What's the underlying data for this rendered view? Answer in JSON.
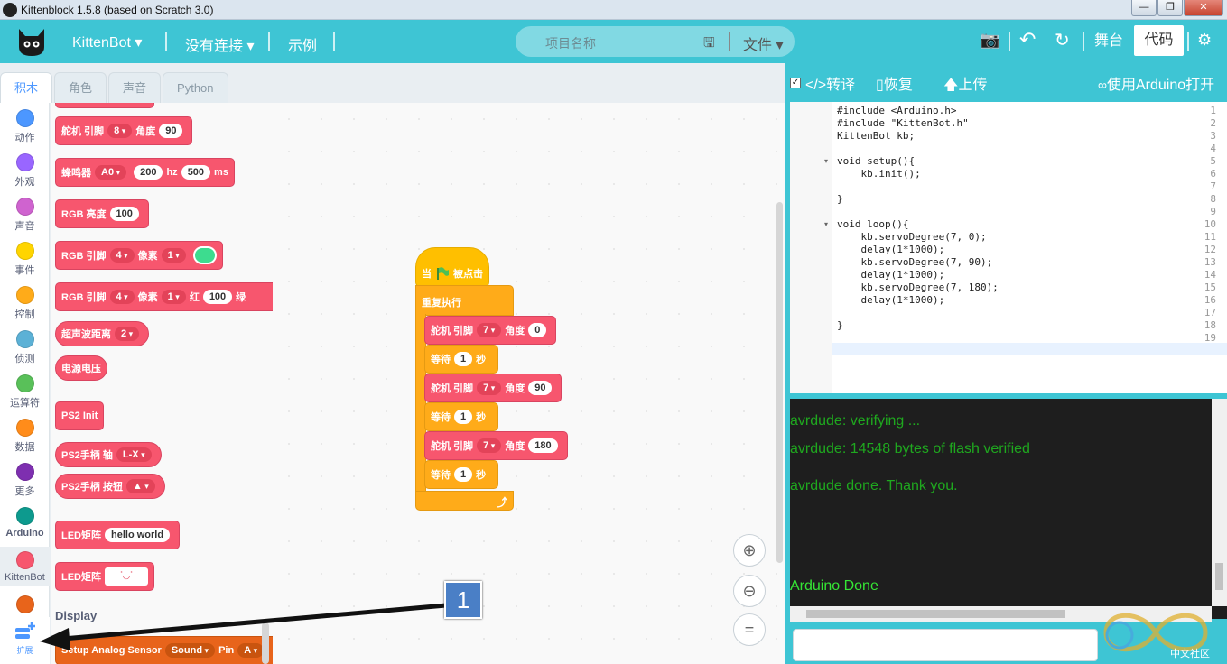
{
  "window": {
    "title": "Kittenblock 1.5.8 (based on Scratch 3.0)",
    "min": "—",
    "max": "❐",
    "close": "✕"
  },
  "menu": {
    "brand": "KittenBot ▾",
    "connect": "没有连接 ▾",
    "examples": "示例",
    "project_placeholder": "项目名称",
    "save_icon": "🖫",
    "file": "文件 ▾",
    "camera_icon": "📷",
    "undo_icon": "↶",
    "redo_icon": "↻",
    "stage": "舞台",
    "code": "代码",
    "settings_icon": "⚙"
  },
  "tabs": [
    "积木",
    "角色",
    "声音",
    "Python"
  ],
  "categories": [
    {
      "label": "动作",
      "color": "#4c97ff"
    },
    {
      "label": "外观",
      "color": "#9966ff"
    },
    {
      "label": "声音",
      "color": "#cf63cf"
    },
    {
      "label": "事件",
      "color": "#ffd500"
    },
    {
      "label": "控制",
      "color": "#ffab19"
    },
    {
      "label": "侦测",
      "color": "#5cb1d6"
    },
    {
      "label": "运算符",
      "color": "#59c059"
    },
    {
      "label": "数据",
      "color": "#ff8c1a"
    },
    {
      "label": "更多",
      "color": "#7e2fb0"
    },
    {
      "label": "Arduino",
      "color": "#0d9a8e"
    },
    {
      "label": "KittenBot",
      "color": "#f7566e"
    },
    {
      "label": "",
      "color": "#e8641b"
    }
  ],
  "extension_label": "扩展",
  "palette": {
    "servo": {
      "label": "舵机 引脚",
      "pin": "8",
      "angle_label": "角度",
      "angle": "90"
    },
    "buzzer": {
      "label": "蜂鸣器",
      "pin": "A0",
      "freq": "200",
      "hz": "hz",
      "dur": "500",
      "ms": "ms"
    },
    "rgb_brightness": {
      "label": "RGB 亮度",
      "value": "100"
    },
    "rgb_pixel": {
      "label": "RGB 引脚",
      "pin": "4",
      "pixel_label": "像素",
      "pixel": "1"
    },
    "rgb_pixel_rgb": {
      "label": "RGB 引脚",
      "pin": "4",
      "pixel_label": "像素",
      "pixel": "1",
      "red_label": "红",
      "red": "100",
      "green_label": "绿"
    },
    "ultrasonic": {
      "label": "超声波距离",
      "pin": "2"
    },
    "voltage": {
      "label": "电源电压"
    },
    "ps2_init": {
      "label": "PS2 Init"
    },
    "ps2_axis": {
      "label": "PS2手柄 轴",
      "axis": "L-X"
    },
    "ps2_button": {
      "label": "PS2手柄 按钮",
      "button": "▲"
    },
    "led_text": {
      "label": "LED矩阵",
      "text": "hello world"
    },
    "led_face": {
      "label": "LED矩阵",
      "face": "˙◡˙"
    },
    "section_display": "Display",
    "analog_sensor": {
      "label": "Setup Analog Sensor",
      "sensor": "Sound",
      "pin_label": "Pin",
      "pin": "A"
    }
  },
  "script": {
    "hat": {
      "when": "当",
      "clicked": "被点击"
    },
    "forever": "重复执行",
    "servo_label": "舵机 引脚",
    "angle_label": "角度",
    "wait_label": "等待",
    "sec_label": "秒",
    "steps": [
      {
        "pin": "7",
        "angle": "0"
      },
      {
        "wait": "1"
      },
      {
        "pin": "7",
        "angle": "90"
      },
      {
        "wait": "1"
      },
      {
        "pin": "7",
        "angle": "180"
      },
      {
        "wait": "1"
      }
    ],
    "loop_arrow": "⤴"
  },
  "zoom": {
    "in": "⊕",
    "out": "⊖",
    "reset": "="
  },
  "toolbar": {
    "compile": "</>转译",
    "restore": "恢复",
    "upload": "上传",
    "open_arduino": "使用Arduino打开"
  },
  "code_lines": [
    "#include <Arduino.h>",
    "#include \"KittenBot.h\"",
    "KittenBot kb;",
    "",
    "void setup(){",
    "    kb.init();",
    "",
    "}",
    "",
    "void loop(){",
    "    kb.servoDegree(7, 0);",
    "    delay(1*1000);",
    "    kb.servoDegree(7, 90);",
    "    delay(1*1000);",
    "    kb.servoDegree(7, 180);",
    "    delay(1*1000);",
    "",
    "}",
    ""
  ],
  "line_numbers": [
    "1",
    "2",
    "3",
    "4",
    "5",
    "6",
    "7",
    "8",
    "9",
    "10",
    "11",
    "12",
    "13",
    "14",
    "15",
    "16",
    "17",
    "18",
    "19"
  ],
  "console": {
    "line1": "avrdude: verifying ...",
    "line2": "avrdude: 14548 bytes of flash verified",
    "line3": "avrdude done. Thank you.",
    "line4": "Arduino Done"
  },
  "watermark": "中文社区",
  "annotation": "1"
}
